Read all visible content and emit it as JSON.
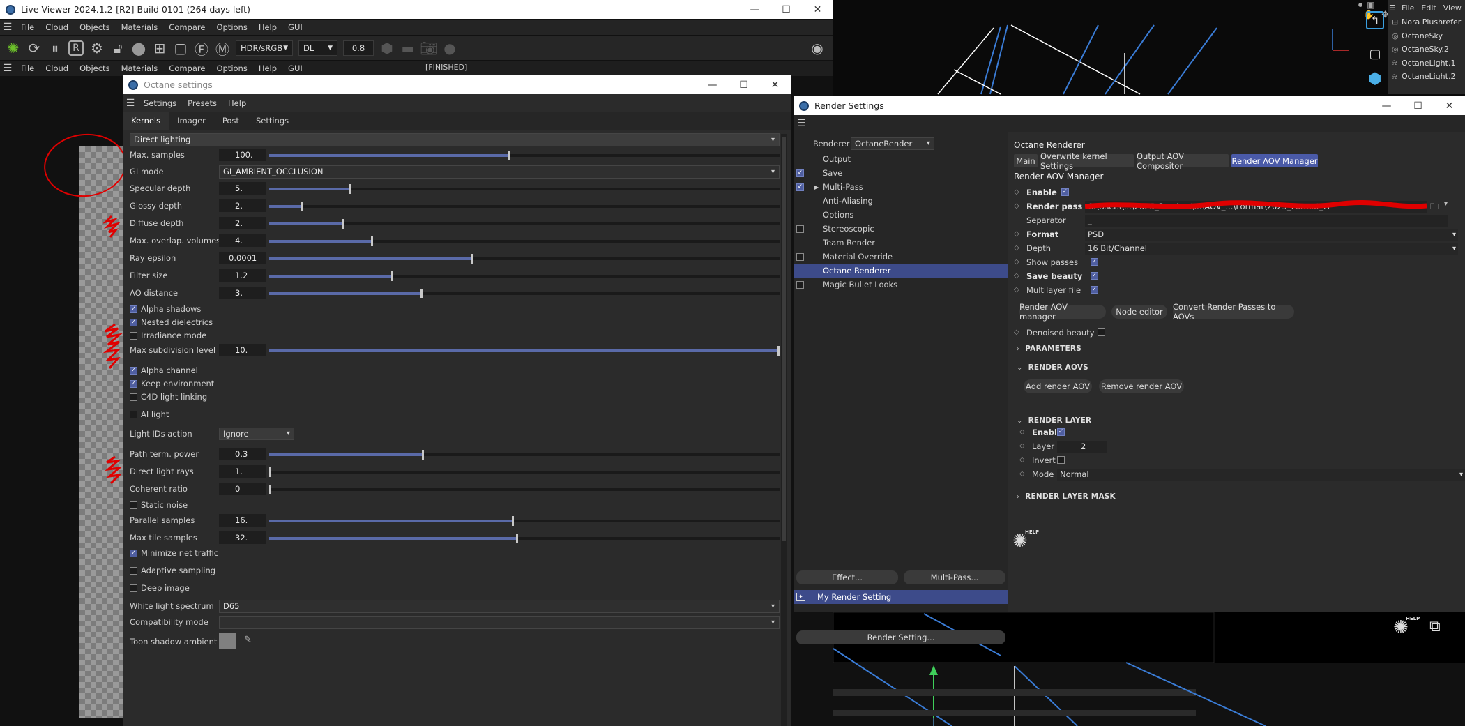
{
  "live_viewer": {
    "title": "Live Viewer 2024.1.2-[R2] Build 0101 (264 days left)",
    "menu": [
      "File",
      "Cloud",
      "Objects",
      "Materials",
      "Compare",
      "Options",
      "Help",
      "GUI"
    ],
    "menu2": [
      "File",
      "Cloud",
      "Objects",
      "Materials",
      "Compare",
      "Options",
      "Help",
      "GUI"
    ],
    "color_space": "HDR/sRGB",
    "kernel": "DL",
    "exposure": "0.8",
    "status": "[FINISHED]"
  },
  "objects_panel": {
    "menu": [
      "File",
      "Edit",
      "View"
    ],
    "items": [
      "Nora Plushrefer",
      "OctaneSky",
      "OctaneSky.2",
      "OctaneLight.1",
      "OctaneLight.2"
    ]
  },
  "octane": {
    "title": "Octane settings",
    "menu": [
      "Settings",
      "Presets",
      "Help"
    ],
    "tabs": [
      "Kernels",
      "Imager",
      "Post",
      "Settings"
    ],
    "kernel_type": "Direct lighting",
    "max_samples": {
      "label": "Max. samples",
      "value": "100.",
      "frac": 0.47
    },
    "gi_mode": {
      "label": "GI mode",
      "value": "GI_AMBIENT_OCCLUSION"
    },
    "specular_depth": {
      "label": "Specular depth",
      "value": "5.",
      "frac": 0.156
    },
    "glossy_depth": {
      "label": "Glossy depth",
      "value": "2.",
      "frac": 0.062
    },
    "diffuse_depth": {
      "label": "Diffuse depth",
      "value": "2.",
      "frac": 0.142
    },
    "max_overlap": {
      "label": "Max. overlap. volumes",
      "value": "4.",
      "frac": 0.2
    },
    "ray_epsilon": {
      "label": "Ray epsilon",
      "value": "0.0001",
      "frac": 0.397
    },
    "filter_size": {
      "label": "Filter size",
      "value": "1.2",
      "frac": 0.24
    },
    "ao_distance": {
      "label": "AO distance",
      "value": "3.",
      "frac": 0.298
    },
    "alpha_shadows": "Alpha shadows",
    "nested_dielectrics": "Nested dielectrics",
    "irradiance_mode": "Irradiance mode",
    "max_subdivision": {
      "label": "Max subdivision level",
      "value": "10.",
      "frac": 1.0
    },
    "alpha_channel": "Alpha channel",
    "keep_environment": "Keep environment",
    "c4d_light_linking": "C4D light linking",
    "ai_light": "AI light",
    "light_ids_action": {
      "label": "Light IDs action",
      "value": "Ignore"
    },
    "path_term_power": {
      "label": "Path term. power",
      "value": "0.3",
      "frac": 0.3
    },
    "direct_light_rays": {
      "label": "Direct light rays",
      "value": "1.",
      "frac": 0.0
    },
    "coherent_ratio": {
      "label": "Coherent ratio",
      "value": "0",
      "frac": 0.0
    },
    "static_noise": "Static noise",
    "parallel_samples": {
      "label": "Parallel samples",
      "value": "16.",
      "frac": 0.478
    },
    "max_tile_samples": {
      "label": "Max tile samples",
      "value": "32.",
      "frac": 0.486
    },
    "minimize_net_traffic": "Minimize net traffic",
    "adaptive_sampling": "Adaptive sampling",
    "deep_image": "Deep image",
    "white_light_spectrum": {
      "label": "White light spectrum",
      "value": "D65"
    },
    "compatibility_mode": {
      "label": "Compatibility mode",
      "value": ""
    },
    "toon_shadow_ambient": {
      "label": "Toon shadow ambient",
      "color": "#808080"
    }
  },
  "render": {
    "title": "Render Settings",
    "renderer_label": "Renderer",
    "renderer_value": "OctaneRender",
    "list": [
      {
        "label": "Output",
        "check": "none"
      },
      {
        "label": "Save",
        "check": "on"
      },
      {
        "label": "Multi-Pass",
        "check": "on",
        "arrow": true
      },
      {
        "label": "Anti-Aliasing",
        "check": "none"
      },
      {
        "label": "Options",
        "check": "none"
      },
      {
        "label": "Stereoscopic",
        "check": "off"
      },
      {
        "label": "Team Render",
        "check": "none"
      },
      {
        "label": "Material Override",
        "check": "off"
      },
      {
        "label": "Octane Renderer",
        "check": "none",
        "selected": true
      },
      {
        "label": "Magic Bullet Looks",
        "check": "off"
      }
    ],
    "effect_button": "Effect...",
    "multipass_button": "Multi-Pass...",
    "preset_name": "My Render Setting",
    "render_setting_button": "Render Setting...",
    "header": "Octane Renderer",
    "tabs": [
      "Main",
      "Overwrite kernel Settings",
      "Output AOV Compositor",
      "Render AOV Manager"
    ],
    "subheader": "Render AOV Manager",
    "enable_label": "Enable",
    "render_pass_file_label": "Render pass file",
    "render_pass_file_value": "C:\\Users\\...\\2025_Renders\\...\\AOV_...\\Format\\2025_Format_Fi",
    "separator_label": "Separator",
    "separator_value": "_",
    "format_label": "Format",
    "format_value": "PSD",
    "depth_label": "Depth",
    "depth_value": "16 Bit/Channel",
    "show_passes_label": "Show passes",
    "save_beauty_label": "Save beauty",
    "multilayer_file_label": "Multilayer file",
    "aov_manager_button": "Render AOV manager",
    "node_editor_button": "Node editor",
    "convert_button": "Convert Render Passes to AOVs",
    "denoised_beauty_label": "Denoised beauty",
    "section_parameters": "PARAMETERS",
    "section_render_aovs": "RENDER AOVS",
    "add_aov_button": "Add render AOV",
    "remove_aov_button": "Remove render AOV",
    "section_render_layer": "RENDER LAYER",
    "layer_enable_label": "Enable",
    "layer_id_label": "Layer ID",
    "layer_id_value": "2",
    "invert_label": "Invert",
    "mode_label": "Mode",
    "mode_value": "Normal",
    "section_render_layer_mask": "RENDER LAYER MASK",
    "help_label": "HELP"
  },
  "viewport_help_label": "HELP",
  "colors": {
    "accent": "#4a5aa8",
    "slider": "#5a6aa8",
    "annotation": "#e00000"
  }
}
